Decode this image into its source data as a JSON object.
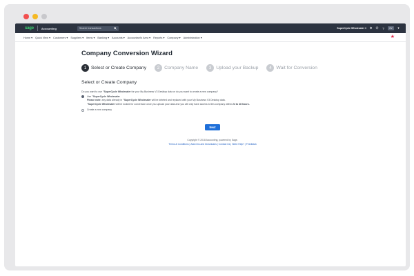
{
  "topbar": {
    "logo": "sage",
    "product": "Accounting",
    "search_placeholder": "Search transactions",
    "company": "SuperCycle Wholesaler",
    "avatar": "GV"
  },
  "nav": {
    "items": [
      "Home ▾",
      "Quick View ▾",
      "Customers ▾",
      "Suppliers ▾",
      "Items ▾",
      "Banking ▾",
      "Accounts ▾",
      "Accountant's Area ▾",
      "Reports ▾",
      "Company ▾",
      "Administration ▾"
    ]
  },
  "wizard": {
    "title": "Company Conversion Wizard",
    "steps": [
      {
        "num": "1",
        "label": "Select or Create Company"
      },
      {
        "num": "2",
        "label": "Company Name"
      },
      {
        "num": "3",
        "label": "Upload your Backup"
      },
      {
        "num": "4",
        "label": "Wait for Conversion"
      }
    ],
    "section_title": "Select or Create Company",
    "question_pre": "Do you want to use ",
    "question_company": "\"SuperCycle Wholesaler",
    "question_post": " for your My Business V3 Desktop data or do you want to create a new company?",
    "option1": {
      "pre": "Use ",
      "company": "\"SuperCycle Wholesaler",
      "note_label": "Please note:",
      "note1_pre": " any data already in ",
      "note1_company": "\"SuperCycle Wholesaler",
      "note1_post": " will be deleted and replaced with your My Business V3 Desktop data.",
      "note2_company": "\"SuperCycle Wholesaler",
      "note2_post": " will be locked for conversion once you upload your data and you will only have access to this company within ",
      "note2_hours": "24 to 48 hours."
    },
    "option2": "Create a new company",
    "next_label": "Next"
  },
  "footer": {
    "copyright": "Copyright © 2018 Accounting, powered by Sage.",
    "links": [
      "Terms & Conditions",
      "Add-Ons and Downloads",
      "Contact Us",
      "Need Help?",
      "Feedback"
    ]
  }
}
